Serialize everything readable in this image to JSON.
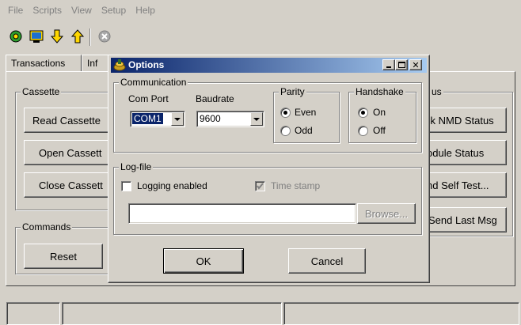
{
  "menu": [
    "File",
    "Scripts",
    "View",
    "Setup",
    "Help"
  ],
  "toolbar_icons": [
    "settings-cog-icon",
    "monitor-icon",
    "download-arrow-icon",
    "upload-arrow-icon",
    "stop-icon"
  ],
  "tabs": [
    "Transactions",
    "Inf"
  ],
  "main": {
    "cassette_legend": "Cassette",
    "read_cassette": "Read Cassette",
    "open_cassette": "Open Cassett",
    "close_cassette": "Close Cassett",
    "commands_legend": "Commands",
    "reset": "Reset",
    "status_legend_fragment": "us",
    "check_nmd_status": "ck NMD Status",
    "module_status": "odule Status",
    "send_self_test": "nd Self Test...",
    "send_last_msg": "Send Last Msg"
  },
  "dialog": {
    "title": "Options",
    "communication_legend": "Communication",
    "com_port_label": "Com Port",
    "com_port_value": "COM1",
    "baudrate_label": "Baudrate",
    "baudrate_value": "9600",
    "parity_legend": "Parity",
    "parity_even": "Even",
    "parity_odd": "Odd",
    "parity_selected": "Even",
    "handshake_legend": "Handshake",
    "handshake_on": "On",
    "handshake_off": "Off",
    "handshake_selected": "On",
    "logfile_legend": "Log-file",
    "logging_enabled": "Logging enabled",
    "logging_checked": false,
    "timestamp": "Time stamp",
    "timestamp_checked": true,
    "logfile_path": "",
    "browse": "Browse...",
    "ok": "OK",
    "cancel": "Cancel"
  },
  "colors": {
    "title_start": "#0a246a",
    "title_end": "#a6caf0",
    "face": "#d4d0c8"
  }
}
